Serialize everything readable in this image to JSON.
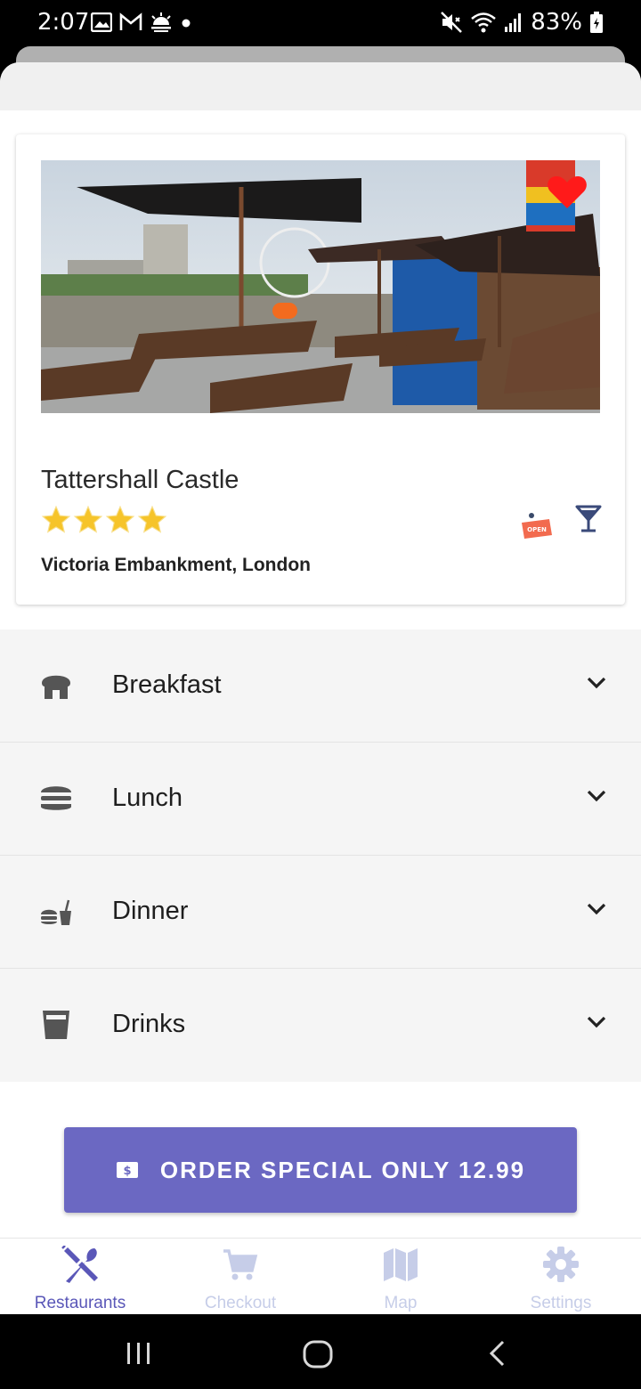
{
  "status_bar": {
    "time": "2:07",
    "battery": "83%",
    "left_icons": [
      "gallery-icon",
      "gmail-icon",
      "weather-icon",
      "dot-icon"
    ],
    "right_icons": [
      "mute-icon",
      "wifi-icon",
      "signal-icon",
      "battery-icon"
    ]
  },
  "restaurant": {
    "name": "Tattershall Castle",
    "rating": 4,
    "address": "Victoria Embankment, London",
    "favorite": true,
    "open_badge": "OPEN"
  },
  "menu": {
    "items": [
      {
        "label": "Breakfast",
        "icon": "bread-icon"
      },
      {
        "label": "Lunch",
        "icon": "burger-icon"
      },
      {
        "label": "Dinner",
        "icon": "meal-icon"
      },
      {
        "label": "Drinks",
        "icon": "glass-icon"
      }
    ]
  },
  "order_button": {
    "label": "ORDER SPECIAL ONLY 12.99",
    "icon": "money-icon"
  },
  "bottom_nav": {
    "tabs": [
      {
        "label": "Restaurants",
        "icon": "utensils-icon",
        "active": true
      },
      {
        "label": "Checkout",
        "icon": "cart-icon",
        "active": false
      },
      {
        "label": "Map",
        "icon": "map-icon",
        "active": false
      },
      {
        "label": "Settings",
        "icon": "gear-icon",
        "active": false
      }
    ]
  },
  "colors": {
    "accent": "#6b68c2",
    "nav_active": "#5a57b8",
    "nav_inactive": "#c6cde8",
    "menu_bg": "#f5f5f5",
    "heart": "#ff1a1a",
    "star": "#f6c42a",
    "open_badge": "#f26b4f"
  }
}
